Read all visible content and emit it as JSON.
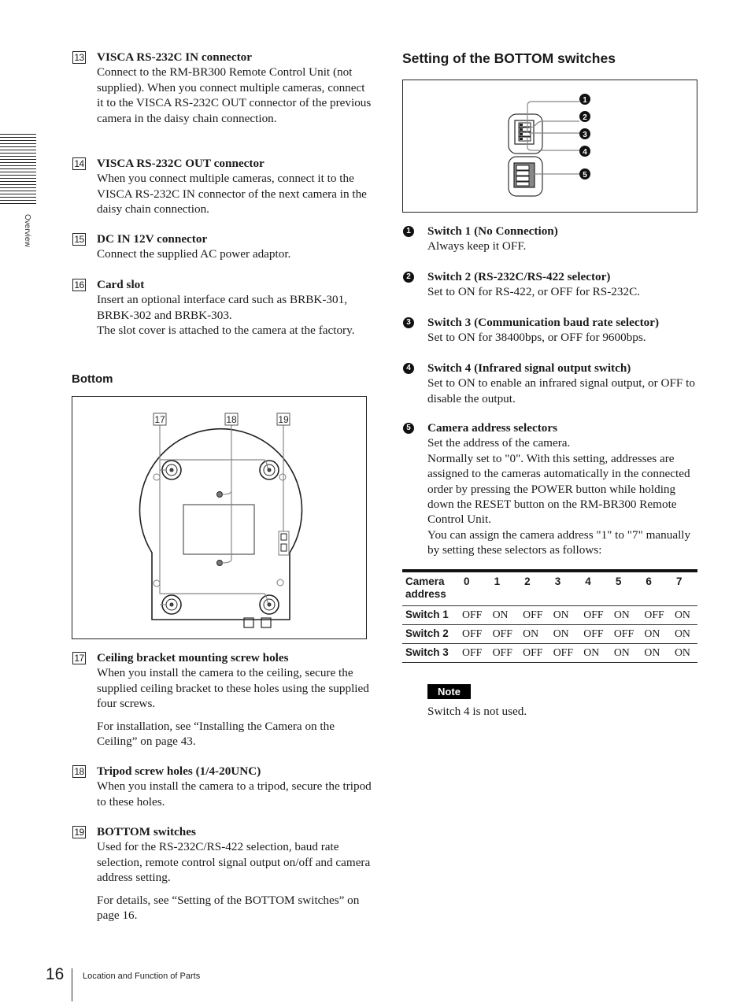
{
  "side_tab": {
    "label": "Overview"
  },
  "left_items": [
    {
      "num": "13",
      "title": "VISCA RS-232C IN connector",
      "paras": [
        "Connect to the RM-BR300 Remote Control Unit (not supplied).  When you connect multiple cameras, connect it to the VISCA RS-232C OUT connector of the previous camera in the daisy chain connection."
      ]
    },
    {
      "num": "14",
      "title": "VISCA RS-232C OUT connector",
      "paras": [
        "When you connect multiple cameras, connect it to the VISCA RS-232C IN connector of the next camera in the daisy chain connection."
      ]
    },
    {
      "num": "15",
      "title": "DC IN 12V connector",
      "paras": [
        "Connect the supplied AC power adaptor."
      ]
    },
    {
      "num": "16",
      "title": "Card slot",
      "paras": [
        "Insert an optional interface card such as BRBK-301, BRBK-302 and BRBK-303.",
        "The slot cover is attached to the camera at the factory."
      ]
    }
  ],
  "bottom_section": {
    "title": "Bottom",
    "figure_callouts": [
      "17",
      "18",
      "19"
    ]
  },
  "bottom_items": [
    {
      "num": "17",
      "title": "Ceiling bracket mounting screw holes",
      "paras": [
        "When you install the camera to the ceiling, secure the supplied ceiling bracket to these holes using the supplied four screws."
      ],
      "extra": "For installation, see “Installing the Camera on the Ceiling” on page 43."
    },
    {
      "num": "18",
      "title": "Tripod screw holes (1/4-20UNC)",
      "paras": [
        "When you install the camera to a tripod, secure the tripod to these holes."
      ]
    },
    {
      "num": "19",
      "title": "BOTTOM switches",
      "paras": [
        "Used for the RS-232C/RS-422 selection, baud rate selection, remote control signal output on/off and camera address setting."
      ],
      "extra": "For details, see “Setting of the BOTTOM switches” on page 16."
    }
  ],
  "switches_section": {
    "title": "Setting of the BOTTOM switches",
    "figure_callouts": [
      "1",
      "2",
      "3",
      "4",
      "5"
    ]
  },
  "switch_items": [
    {
      "num": "1",
      "title": "Switch 1 (No Connection)",
      "lines": [
        "Always keep it OFF."
      ]
    },
    {
      "num": "2",
      "title": "Switch 2 (RS-232C/RS-422 selector)",
      "lines": [
        "Set to ON for RS-422, or OFF for RS-232C."
      ]
    },
    {
      "num": "3",
      "title": "Switch 3 (Communication baud rate selector)",
      "lines": [
        "Set to ON for 38400bps, or OFF for 9600bps."
      ]
    },
    {
      "num": "4",
      "title": "Switch 4 (Infrared signal output switch)",
      "lines": [
        "Set to ON to enable an infrared signal output, or OFF to disable the output."
      ]
    },
    {
      "num": "5",
      "title": "Camera address selectors",
      "lines": [
        "Set the address of the camera.",
        "Normally set to \"0\".  With this setting, addresses are assigned to the cameras automatically in the connected order by pressing the POWER button while holding down the RESET button on the RM-BR300 Remote Control Unit.",
        "You can assign the camera address \"1\" to \"7\" manually by setting these selectors as follows:"
      ]
    }
  ],
  "address_table": {
    "header_label": "Camera address",
    "columns": [
      "0",
      "1",
      "2",
      "3",
      "4",
      "5",
      "6",
      "7"
    ],
    "rows": [
      {
        "label": "Switch 1",
        "values": [
          "OFF",
          "ON",
          "OFF",
          "ON",
          "OFF",
          "ON",
          "OFF",
          "ON"
        ]
      },
      {
        "label": "Switch 2",
        "values": [
          "OFF",
          "OFF",
          "ON",
          "ON",
          "OFF",
          "OFF",
          "ON",
          "ON"
        ]
      },
      {
        "label": "Switch 3",
        "values": [
          "OFF",
          "OFF",
          "OFF",
          "OFF",
          "ON",
          "ON",
          "ON",
          "ON"
        ]
      }
    ]
  },
  "note": {
    "badge": "Note",
    "text": "Switch 4 is not used."
  },
  "footer": {
    "page_number": "16",
    "section": "Location and Function of Parts"
  }
}
